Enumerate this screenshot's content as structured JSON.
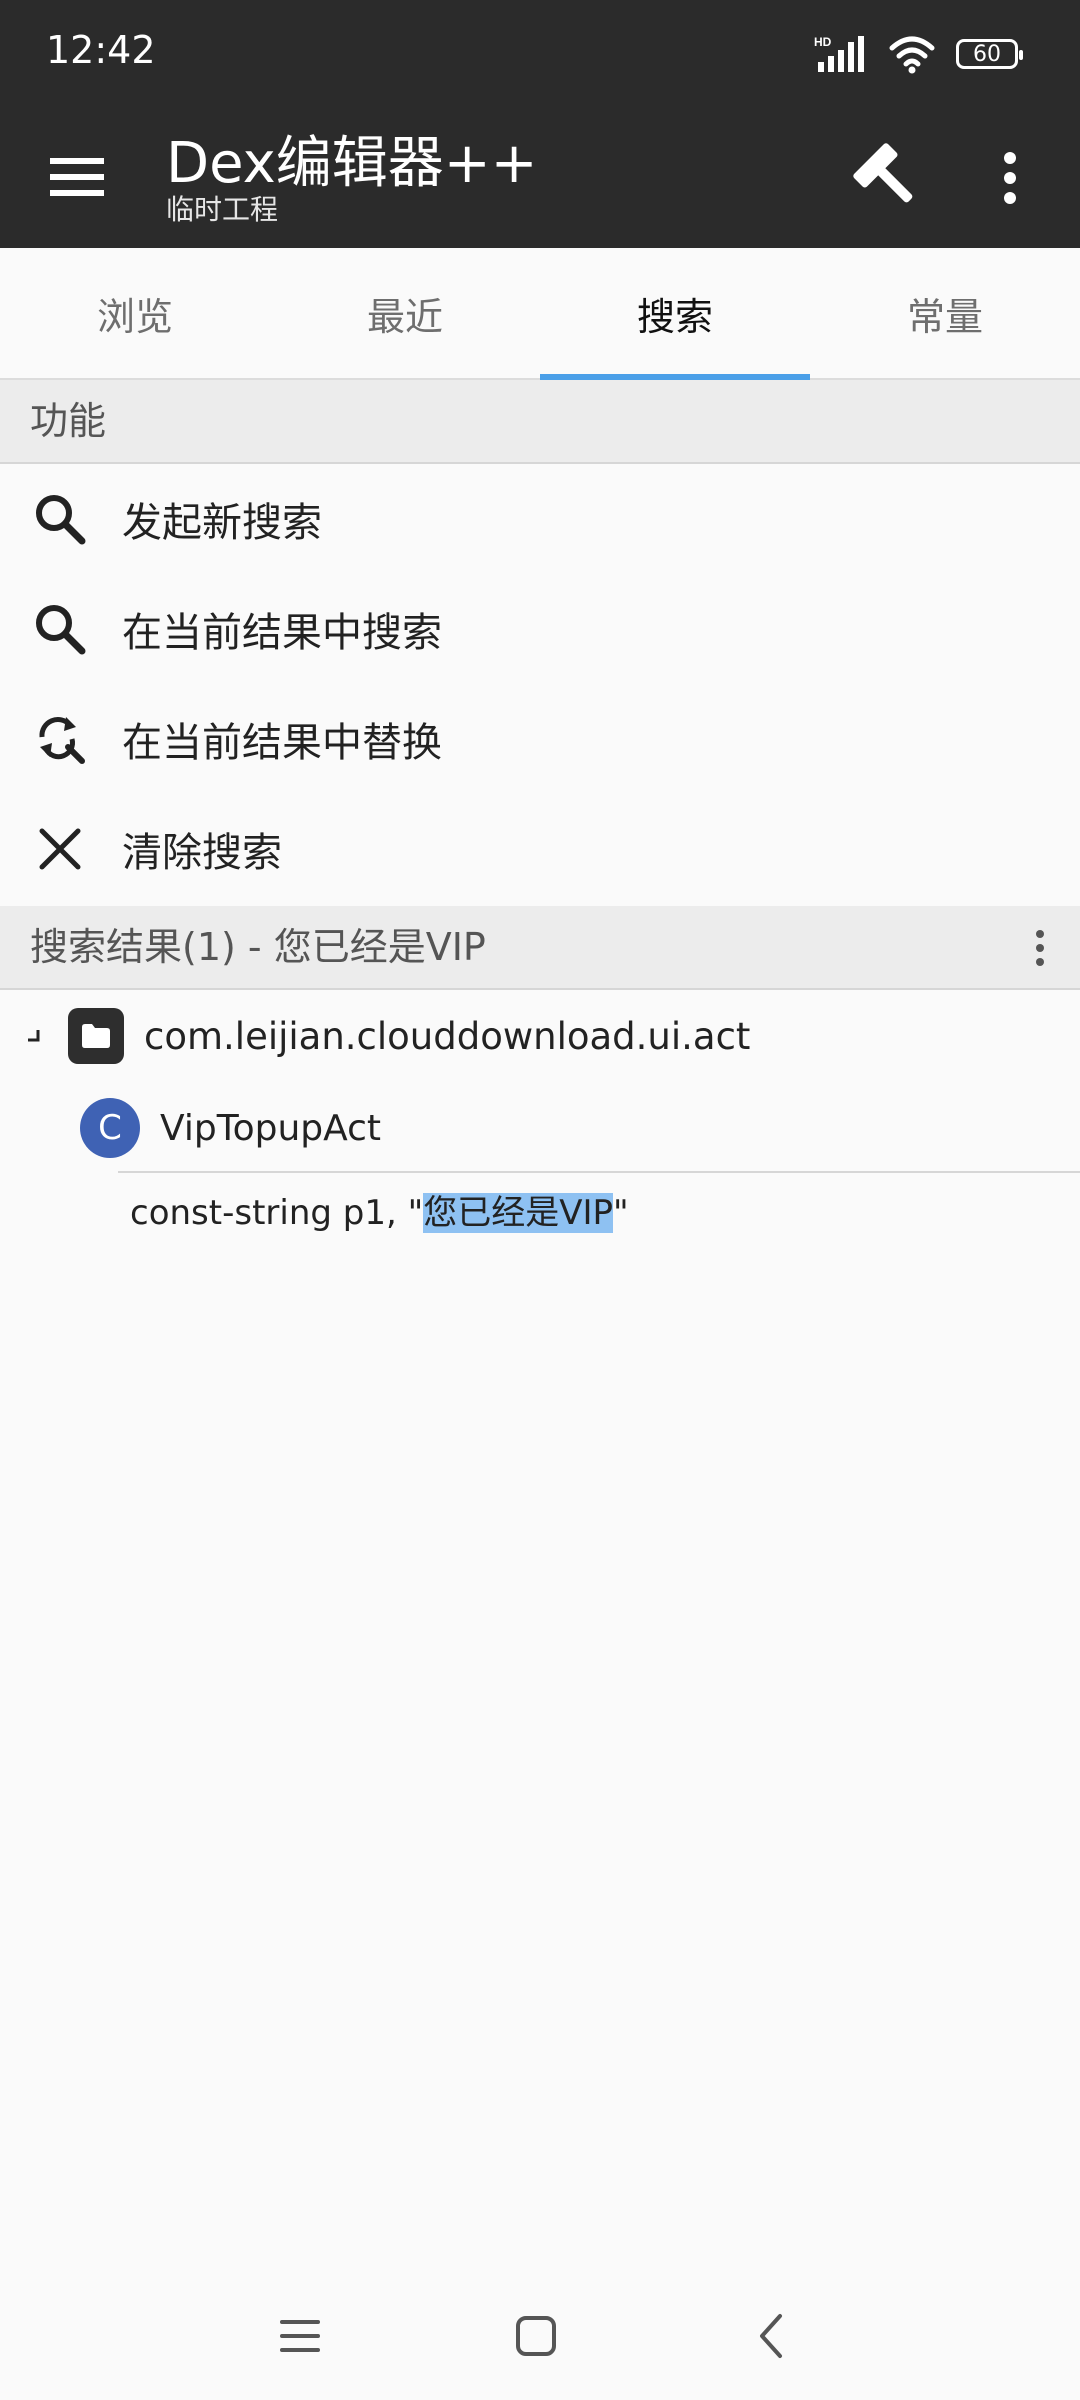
{
  "status_bar": {
    "time": "12:42",
    "battery": "60",
    "network": "HD"
  },
  "app_bar": {
    "title": "Dex编辑器++",
    "subtitle": "临时工程"
  },
  "tabs": [
    {
      "label": "浏览",
      "active": false
    },
    {
      "label": "最近",
      "active": false
    },
    {
      "label": "搜索",
      "active": true
    },
    {
      "label": "常量",
      "active": false
    }
  ],
  "functions": {
    "header": "功能",
    "items": [
      {
        "label": "发起新搜索",
        "icon": "search-icon"
      },
      {
        "label": "在当前结果中搜索",
        "icon": "search-icon"
      },
      {
        "label": "在当前结果中替换",
        "icon": "find-replace-icon"
      },
      {
        "label": "清除搜索",
        "icon": "close-icon"
      }
    ]
  },
  "results": {
    "header": "搜索结果(1) - 您已经是VIP",
    "package": "com.leijian.clouddownload.ui.act",
    "class_badge": "C",
    "class_name": "VipTopupAct",
    "code_prefix": "const-string p1, \"",
    "code_match": "您已经是VIP",
    "code_suffix": "\""
  },
  "colors": {
    "toolbar": "#2b2b2b",
    "accent": "#4a9fe8",
    "class_badge": "#3f62b4",
    "highlight": "#8ec1f2"
  }
}
